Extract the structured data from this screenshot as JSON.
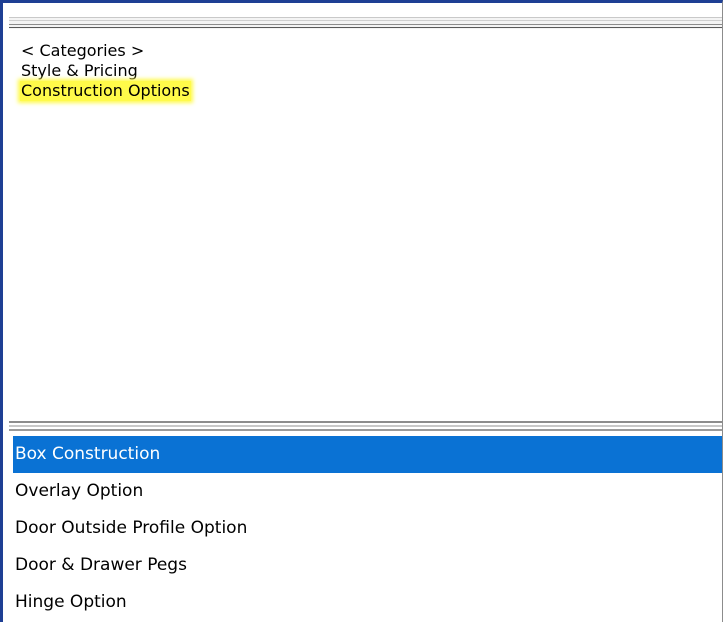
{
  "categories": {
    "items": [
      {
        "label": "< Categories >"
      },
      {
        "label": "Style & Pricing"
      },
      {
        "label": "Construction Options",
        "highlighted": true
      }
    ]
  },
  "options": {
    "items": [
      {
        "label": "Box Construction",
        "selected": true
      },
      {
        "label": "Overlay Option"
      },
      {
        "label": "Door Outside Profile Option"
      },
      {
        "label": "Door & Drawer Pegs"
      },
      {
        "label": "Hinge Option"
      }
    ]
  },
  "colors": {
    "selection": "#0a72d4",
    "highlight": "#fffa4a",
    "frame": "#1e3f94"
  }
}
